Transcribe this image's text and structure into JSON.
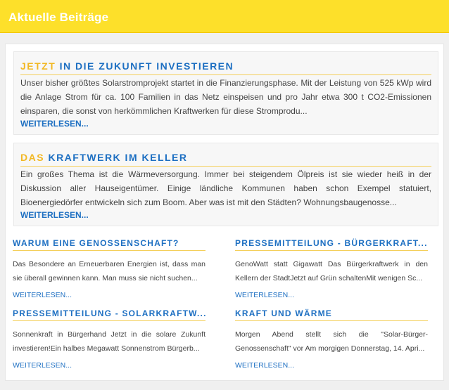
{
  "header": {
    "title": "Aktuelle Beiträge"
  },
  "features": [
    {
      "title_prefix": "JETZT",
      "title_main": "IN DIE ZUKUNFT INVESTIEREN",
      "text": "Unser bisher größtes Solarstromprojekt startet in die Finanzierungsphase. Mit der Leistung von 525 kWp wird die Anlage Strom für ca. 100 Familien in das Netz einspeisen und pro Jahr etwa 300 t CO2-Emissionen einsparen, die sonst von herkömmlichen Kraftwerken für diese Stromprodu...",
      "link": "WEITERLESEN..."
    },
    {
      "title_prefix": "DAS",
      "title_main": "KRAFTWERK IM KELLER",
      "text": "Ein großes Thema ist die Wärmeversorgung. Immer bei steigendem Ölpreis ist sie wieder heiß in der Diskussion aller Hauseigentümer. Einige ländliche Kommunen haben schon Exempel statuiert, Bioenergiedörfer entwickeln sich zum Boom. Aber was ist mit den Städten? Wohnungsbaugenosse...",
      "link": "WEITERLESEN..."
    }
  ],
  "articles": [
    {
      "title": "WARUM EINE GENOSSENSCHAFT?",
      "text": "Das Besondere an Erneuerbaren Energien ist, dass man sie überall gewinnen kann. Man muss sie nicht suchen...",
      "link": "WEITERLESEN..."
    },
    {
      "title": "PRESSEMITTEILUNG - BÜRGERKRAFT...",
      "text": "GenoWatt statt Gigawatt Das Bürgerkraftwerk in den Kellern der StadtJetzt auf Grün schaltenMit wenigen Sc...",
      "link": "WEITERLESEN..."
    },
    {
      "title": "PRESSEMITTEILUNG - SOLARKRAFTW...",
      "text": "Sonnenkraft in Bürgerhand Jetzt in die solare Zukunft investieren!Ein halbes Megawatt Sonnenstrom Bürgerb...",
      "link": "WEITERLESEN..."
    },
    {
      "title": "KRAFT UND WÄRME",
      "text": "Morgen Abend stellt sich die \"Solar-Bürger-Genossenschaft\" vor Am morgigen Donnerstag, 14. Apri...",
      "link": "WEITERLESEN..."
    }
  ],
  "colors": {
    "header_bg": "#fde02a",
    "accent_blue": "#1d6fc2",
    "accent_yellow": "#f2b824"
  }
}
